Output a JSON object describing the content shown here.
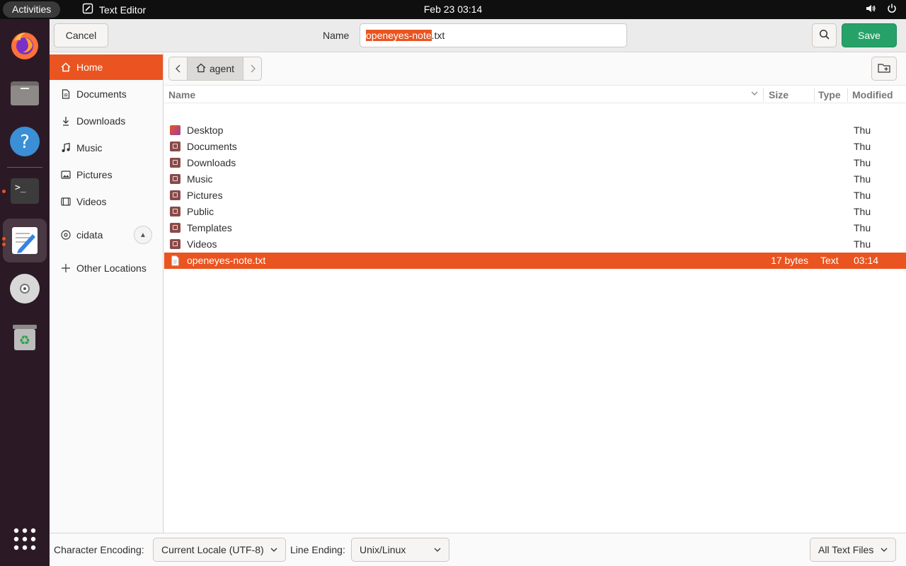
{
  "topbar": {
    "activities": "Activities",
    "app_name": "Text Editor",
    "clock": "Feb 23  03:14"
  },
  "dock": {
    "apps": [
      "firefox-icon",
      "files-icon",
      "help-icon",
      "terminal-icon",
      "text-editor-icon",
      "disc-icon",
      "trash-icon",
      "app-grid-icon"
    ]
  },
  "dialog": {
    "cancel": "Cancel",
    "name_label": "Name",
    "filename_selected": "openeyes-note",
    "filename_rest": ".txt",
    "save": "Save"
  },
  "sidebar": {
    "items": [
      {
        "label": "Home",
        "icon": "home-icon"
      },
      {
        "label": "Documents",
        "icon": "document-icon"
      },
      {
        "label": "Downloads",
        "icon": "download-icon"
      },
      {
        "label": "Music",
        "icon": "music-icon"
      },
      {
        "label": "Pictures",
        "icon": "pictures-icon"
      },
      {
        "label": "Videos",
        "icon": "videos-icon"
      },
      {
        "label": "cidata",
        "icon": "drive-icon"
      },
      {
        "label": "Other Locations",
        "icon": "plus-icon"
      }
    ]
  },
  "pathbar": {
    "current": "agent"
  },
  "columns": {
    "name": "Name",
    "size": "Size",
    "type": "Type",
    "modified": "Modified"
  },
  "files": [
    {
      "name": "Desktop",
      "size": "",
      "type": "",
      "modified": "Thu"
    },
    {
      "name": "Documents",
      "size": "",
      "type": "",
      "modified": "Thu"
    },
    {
      "name": "Downloads",
      "size": "",
      "type": "",
      "modified": "Thu"
    },
    {
      "name": "Music",
      "size": "",
      "type": "",
      "modified": "Thu"
    },
    {
      "name": "Pictures",
      "size": "",
      "type": "",
      "modified": "Thu"
    },
    {
      "name": "Public",
      "size": "",
      "type": "",
      "modified": "Thu"
    },
    {
      "name": "Templates",
      "size": "",
      "type": "",
      "modified": "Thu"
    },
    {
      "name": "Videos",
      "size": "",
      "type": "",
      "modified": "Thu"
    },
    {
      "name": "openeyes-note.txt",
      "size": "17 bytes",
      "type": "Text",
      "modified": "03:14"
    }
  ],
  "footer": {
    "encoding_label": "Character Encoding:",
    "encoding_value": "Current Locale (UTF-8)",
    "line_ending_label": "Line Ending:",
    "line_ending_value": "Unix/Linux",
    "filter_value": "All Text Files"
  },
  "colors": {
    "accent": "#e95420",
    "save": "#26a269"
  }
}
